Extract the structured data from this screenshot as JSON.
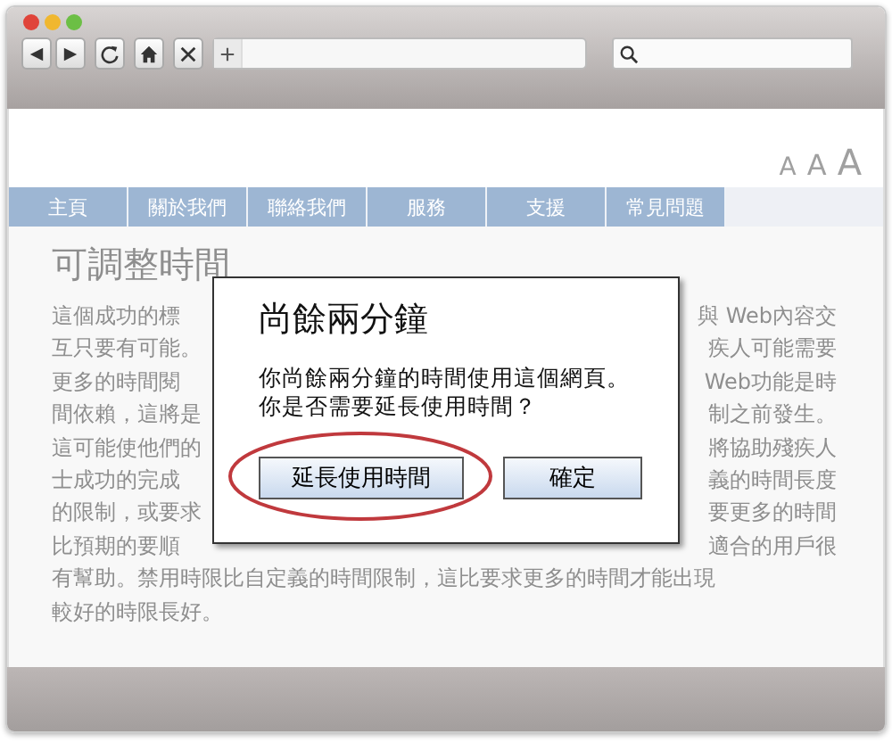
{
  "font_sizes": [
    "A",
    "A",
    "A"
  ],
  "nav": [
    {
      "label": "主頁"
    },
    {
      "label": "關於我們"
    },
    {
      "label": "聯絡我們"
    },
    {
      "label": "服務"
    },
    {
      "label": "支援"
    },
    {
      "label": "常見問題"
    }
  ],
  "page": {
    "heading": "可調整時間",
    "lines": [
      {
        "left": "這個成功的標",
        "right": "與 Web內容交"
      },
      {
        "left": "互只要有可能。",
        "right": "疾人可能需要"
      },
      {
        "left": "更多的時間閱",
        "right": "Web功能是時"
      },
      {
        "left": "間依賴，這將是",
        "right": "制之前發生。"
      },
      {
        "left": "這可能使他們的",
        "right": "將協助殘疾人"
      },
      {
        "left": "士成功的完成",
        "right": "義的時間長度"
      },
      {
        "left": "的限制，或要求",
        "right": "要更多的時間"
      },
      {
        "left": "比預期的要順",
        "right": "適合的用戶很"
      },
      {
        "left": "有幫助。禁用時限比自定義的時間限制，這比要求更多的時間才能出現"
      },
      {
        "left": "較好的時限長好。"
      }
    ]
  },
  "dialog": {
    "title": "尚餘兩分鐘",
    "message": [
      "你尚餘兩分鐘的時間使用這個網頁。",
      "你是否需要延長使用時間？"
    ],
    "buttons": [
      {
        "label": "延長使用時間",
        "highlighted": true
      },
      {
        "label": "確定",
        "highlighted": false
      }
    ]
  }
}
